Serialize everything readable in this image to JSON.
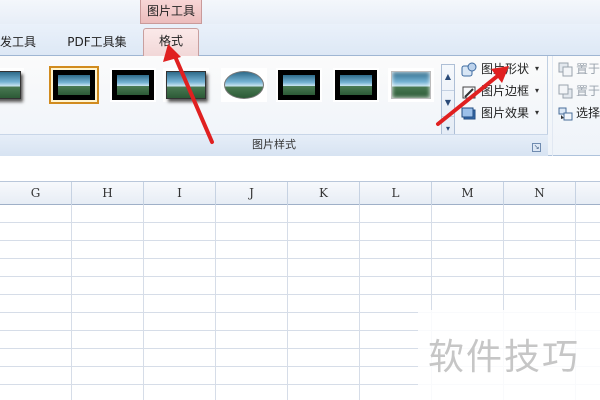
{
  "context_tab_group": {
    "label": "图片工具"
  },
  "tabs": [
    {
      "label": "发工具"
    },
    {
      "label": "PDF工具集"
    },
    {
      "label": "格式",
      "active": true
    }
  ],
  "picture_styles": {
    "group_title": "图片样式",
    "launcher": "↘",
    "gallery_scroll": [
      "▲",
      "▼",
      "▾"
    ],
    "commands": [
      {
        "label": "图片形状",
        "icon": "picture-shape-icon",
        "dropdown": "▾"
      },
      {
        "label": "图片边框",
        "icon": "picture-border-icon",
        "dropdown": "▾"
      },
      {
        "label": "图片效果",
        "icon": "picture-effects-icon",
        "dropdown": "▾"
      }
    ]
  },
  "arrange": {
    "commands": [
      {
        "label": "置于",
        "icon": "bring-forward-icon"
      },
      {
        "label": "置于",
        "icon": "send-backward-icon"
      },
      {
        "label": "选择",
        "icon": "selection-pane-icon"
      }
    ]
  },
  "sheet": {
    "columns": [
      "G",
      "H",
      "I",
      "J",
      "K",
      "L",
      "M",
      "N"
    ]
  },
  "watermark": "软件技巧",
  "colors": {
    "active_tab": "#f1d7d7",
    "arrow": "#e02020",
    "ribbon_border": "#9fb6d3"
  }
}
